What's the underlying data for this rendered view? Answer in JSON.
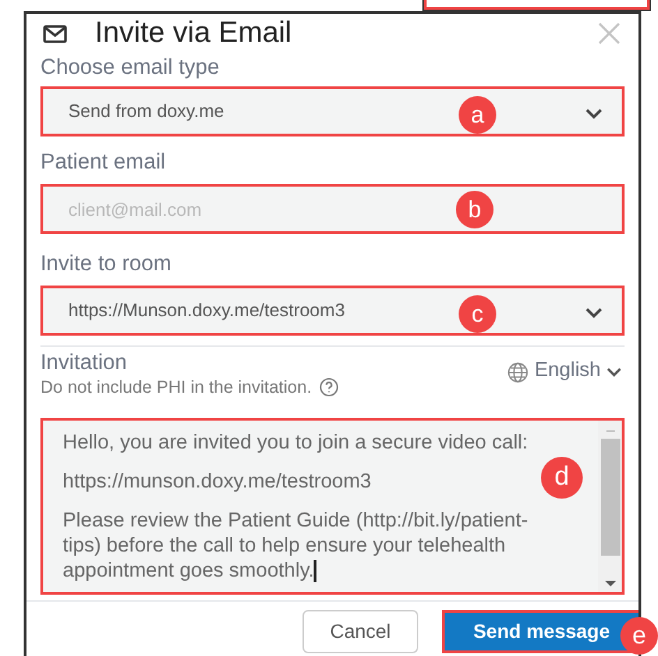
{
  "dialog": {
    "title": "Invite via Email",
    "fields": [
      {
        "kind": "select",
        "label": "Choose email type",
        "value": "Send from doxy.me",
        "callout": "a"
      },
      {
        "kind": "input",
        "label": "Patient email",
        "placeholder": "client@mail.com",
        "callout": "b"
      },
      {
        "kind": "select",
        "label": "Invite to room",
        "value": "https://Munson.doxy.me/testroom3",
        "callout": "c"
      }
    ],
    "invitation": {
      "label": "Invitation",
      "note": "Do not include PHI in the invitation.",
      "language": "English",
      "callout": "d",
      "paragraphs": [
        "Hello, you are invited you to join a secure video call:",
        "https://munson.doxy.me/testroom3",
        "Please review the Patient Guide (http://bit.ly/patient-tips) before the call to help ensure your telehealth appointment goes smoothly."
      ]
    },
    "buttons": [
      {
        "kind": "secondary",
        "label": "Cancel"
      },
      {
        "kind": "primary",
        "label": "Send message",
        "callout": "e"
      }
    ]
  }
}
